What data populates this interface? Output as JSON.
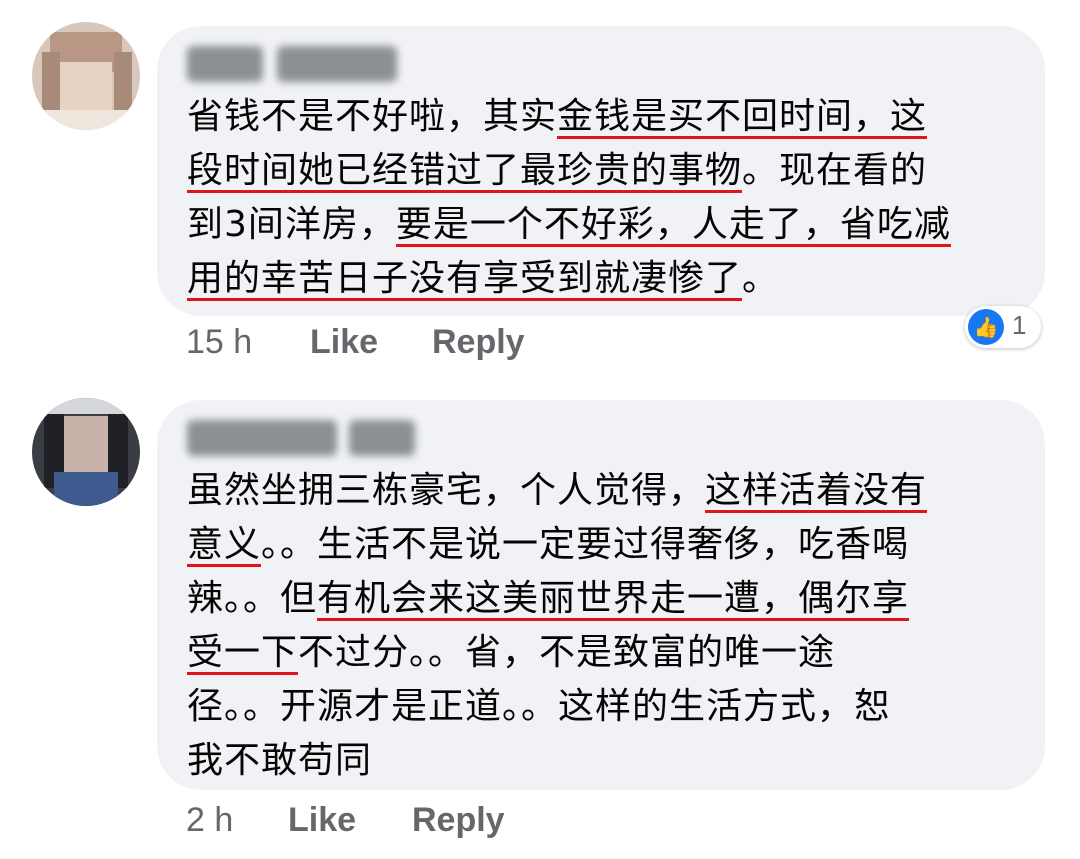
{
  "comments": [
    {
      "author": "",
      "lines": [
        [
          {
            "t": "省钱不是不好啦，其实"
          },
          {
            "t": "金钱是买不回时间，这",
            "u": true
          }
        ],
        [
          {
            "t": "段时间她已经错过了最珍贵的事物",
            "u": true
          },
          {
            "t": "。现在看的"
          }
        ],
        [
          {
            "t": "到3间洋房，"
          },
          {
            "t": "要是一个不好彩，人走了，省吃减",
            "u": true
          }
        ],
        [
          {
            "t": "用的幸苦日子没有享受到就凄惨了",
            "u": true
          },
          {
            "t": "。"
          }
        ]
      ],
      "time": "15 h",
      "like_label": "Like",
      "reply_label": "Reply",
      "reaction_icon": "thumbs-up-icon",
      "reaction_count": "1"
    },
    {
      "author": "",
      "lines": [
        [
          {
            "t": "虽然坐拥三栋豪宅，个人觉得，"
          },
          {
            "t": "这样活着没有",
            "u": true
          }
        ],
        [
          {
            "t": "意义",
            "u": true
          },
          {
            "t": "。。生活不是说一定要过得奢侈，吃香喝"
          }
        ],
        [
          {
            "t": "辣。。但"
          },
          {
            "t": "有机会来这美丽世界走一遭，偶尔享",
            "u": true
          }
        ],
        [
          {
            "t": "受一下",
            "u": true
          },
          {
            "t": "不过分。。省，不是致富的唯一途"
          }
        ],
        [
          {
            "t": "径。。开源才是正道。。这样的生活方式，恕"
          }
        ],
        [
          {
            "t": "我不敢苟同"
          }
        ]
      ],
      "time": "2 h",
      "like_label": "Like",
      "reply_label": "Reply"
    }
  ],
  "colors": {
    "underline": "#e0141b",
    "bubble": "#f0f2f5",
    "meta": "#65676b",
    "like_blue": "#1877f2"
  }
}
